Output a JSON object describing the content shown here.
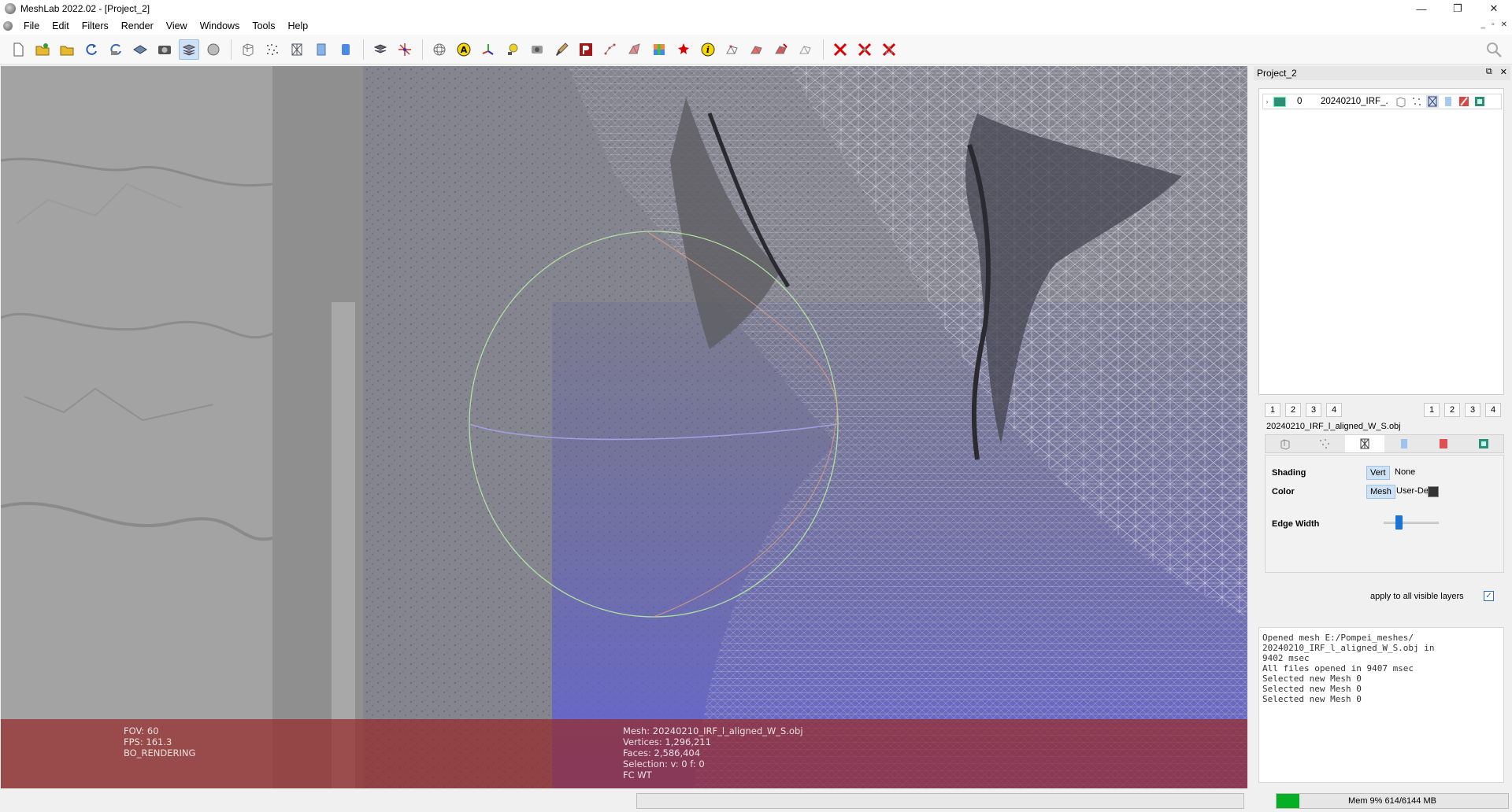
{
  "window": {
    "title": "MeshLab 2022.02 - [Project_2]",
    "minimize": "—",
    "maximize": "❐",
    "close": "✕"
  },
  "menubar": {
    "items": [
      "File",
      "Edit",
      "Filters",
      "Render",
      "View",
      "Windows",
      "Tools",
      "Help"
    ],
    "mdi_minimize": "_",
    "mdi_restore": "▫",
    "mdi_close": "✕"
  },
  "toolbar": {
    "icons": [
      "new-project-icon",
      "open-project-icon",
      "import-mesh-icon",
      "reload-icon",
      "reload-all-icon",
      "export-mesh-icon",
      "snapshot-icon",
      "layers-icon",
      "raster-icon",
      "bbox-icon",
      "points-icon",
      "wireframe-icon",
      "flat-icon",
      "smooth-icon",
      "layer-dialog-icon",
      "align-axes-icon",
      "trackball-icon",
      "annotation-icon",
      "axis-icon",
      "light-icon",
      "camera-icon",
      "paint-icon",
      "measure-icon",
      "select-vertices-icon",
      "select-faces-icon",
      "color-icon",
      "georef-icon",
      "info-icon",
      "select-conn-icon",
      "delete-faces-icon",
      "delete-vertices-icon",
      "move-icon",
      "delete-edit-1-icon",
      "delete-edit-2-icon",
      "delete-edit-3-icon"
    ]
  },
  "viewport": {
    "info_left": [
      "FOV: 60",
      "FPS:   161.3",
      "BO_RENDERING"
    ],
    "info_right": [
      "Mesh: 20240210_IRF_l_aligned_W_S.obj",
      "Vertices: 1,296,211",
      "Faces: 2,586,404",
      "Selection: v: 0 f: 0",
      "FC WT"
    ]
  },
  "statusbar": {
    "memory_text": "Mem 9% 614/6144 MB",
    "memory_fraction": 0.1
  },
  "panel": {
    "title": "Project_2",
    "float_btn": "⧉",
    "close_btn": "✕",
    "layer": {
      "expand": "›",
      "id": "0",
      "name": "20240210_IRF_..."
    },
    "tabs_left": [
      "1",
      "2",
      "3",
      "4"
    ],
    "tabs_right": [
      "1",
      "2",
      "3",
      "4"
    ],
    "mesh_name": "20240210_IRF_l_aligned_W_S.obj",
    "shading_label": "Shading",
    "shading_opts": [
      "Vert",
      "None"
    ],
    "color_label": "Color",
    "color_opts": [
      "Mesh",
      "User-Def"
    ],
    "edge_label": "Edge Width",
    "edge_width_fraction": 0.27,
    "apply_label": "apply to all visible layers",
    "apply_checked": true,
    "check_mark": "✓"
  },
  "log": [
    "Opened mesh E:/Pompei_meshes/",
    "20240210_IRF_l_aligned_W_S.obj in",
    "9402 msec",
    "All files opened in 9407 msec",
    "Selected new Mesh 0",
    "Selected new Mesh 0",
    "Selected new Mesh 0"
  ]
}
